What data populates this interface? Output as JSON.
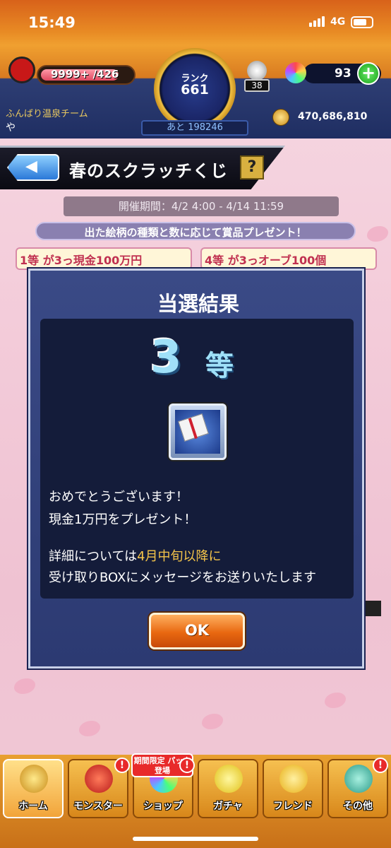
{
  "status_bar": {
    "time": "15:49",
    "network": "4G"
  },
  "header": {
    "hp_text": "9999+ /426",
    "rank_label": "ランク",
    "rank_value": "661",
    "next_label": "あと 198246",
    "stamina_value": "38",
    "orb_count": "93",
    "team_name": "ふんばり温泉チーム",
    "player_name": "や",
    "gold": "470,686,810"
  },
  "page": {
    "title": "春のスクラッチくじ",
    "help_label": "?",
    "period": "開催期間：4/2 4:00 - 4/14 11:59",
    "prize_info": "出た絵柄の種類と数に応じて賞品プレゼント！",
    "prize_rows": [
      {
        "text": "1等 が3っ現金100万円"
      },
      {
        "text": "4等 が3っオーブ100個"
      }
    ]
  },
  "modal": {
    "title": "当選結果",
    "rank_number": "3",
    "rank_suffix": "等",
    "line1": "おめでとうございます！",
    "line2": "現金1万円をプレゼント！",
    "line3_a": "詳細については",
    "line3_b": "4月中旬以降に",
    "line4": "受け取りBOXにメッセージをお送りいたします",
    "ok_label": "OK"
  },
  "nav": {
    "items": [
      {
        "label": "ホーム"
      },
      {
        "label": "モンスター"
      },
      {
        "label": "ショップ"
      },
      {
        "label": "ガチャ"
      },
      {
        "label": "フレンド"
      },
      {
        "label": "その他"
      }
    ],
    "shop_badge": "期間限定 パック登場",
    "alert": "!"
  },
  "colors": {
    "accent": "#e86810",
    "highlight": "#f5c54a",
    "modal_bg": "#2c3a72"
  }
}
